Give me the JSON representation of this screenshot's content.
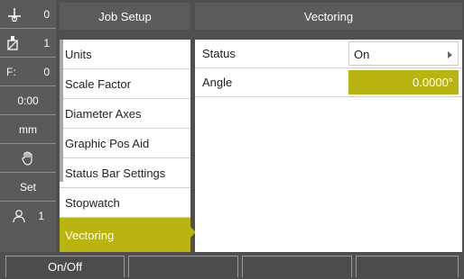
{
  "status_bar": {
    "items": [
      {
        "icon": "datum-icon",
        "value": "0"
      },
      {
        "icon": "tool-icon",
        "value": "1"
      },
      {
        "label": "F:",
        "value": "0"
      },
      {
        "value": "0:00"
      },
      {
        "value": "mm"
      },
      {
        "icon": "hand-icon"
      },
      {
        "value": "Set"
      },
      {
        "icon": "user-icon",
        "value": "1"
      }
    ]
  },
  "menu": {
    "title": "Job Setup",
    "items": [
      {
        "label": "Units"
      },
      {
        "label": "Scale Factor"
      },
      {
        "label": "Diameter Axes"
      },
      {
        "label": "Graphic Pos Aid"
      },
      {
        "label": "Status Bar Settings"
      },
      {
        "label": "Stopwatch"
      },
      {
        "label": "Vectoring",
        "active": true
      }
    ]
  },
  "panel": {
    "title": "Vectoring",
    "rows": [
      {
        "label": "Status",
        "value": "On"
      },
      {
        "label": "Angle",
        "value": "0.0000°"
      }
    ]
  },
  "softkeys": [
    {
      "label": "On/Off"
    },
    {
      "label": ""
    },
    {
      "label": ""
    },
    {
      "label": ""
    },
    {
      "label": ""
    }
  ],
  "colors": {
    "accent": "#b9b40f",
    "background": "#4f4f4f",
    "header": "#5b5b5b"
  }
}
